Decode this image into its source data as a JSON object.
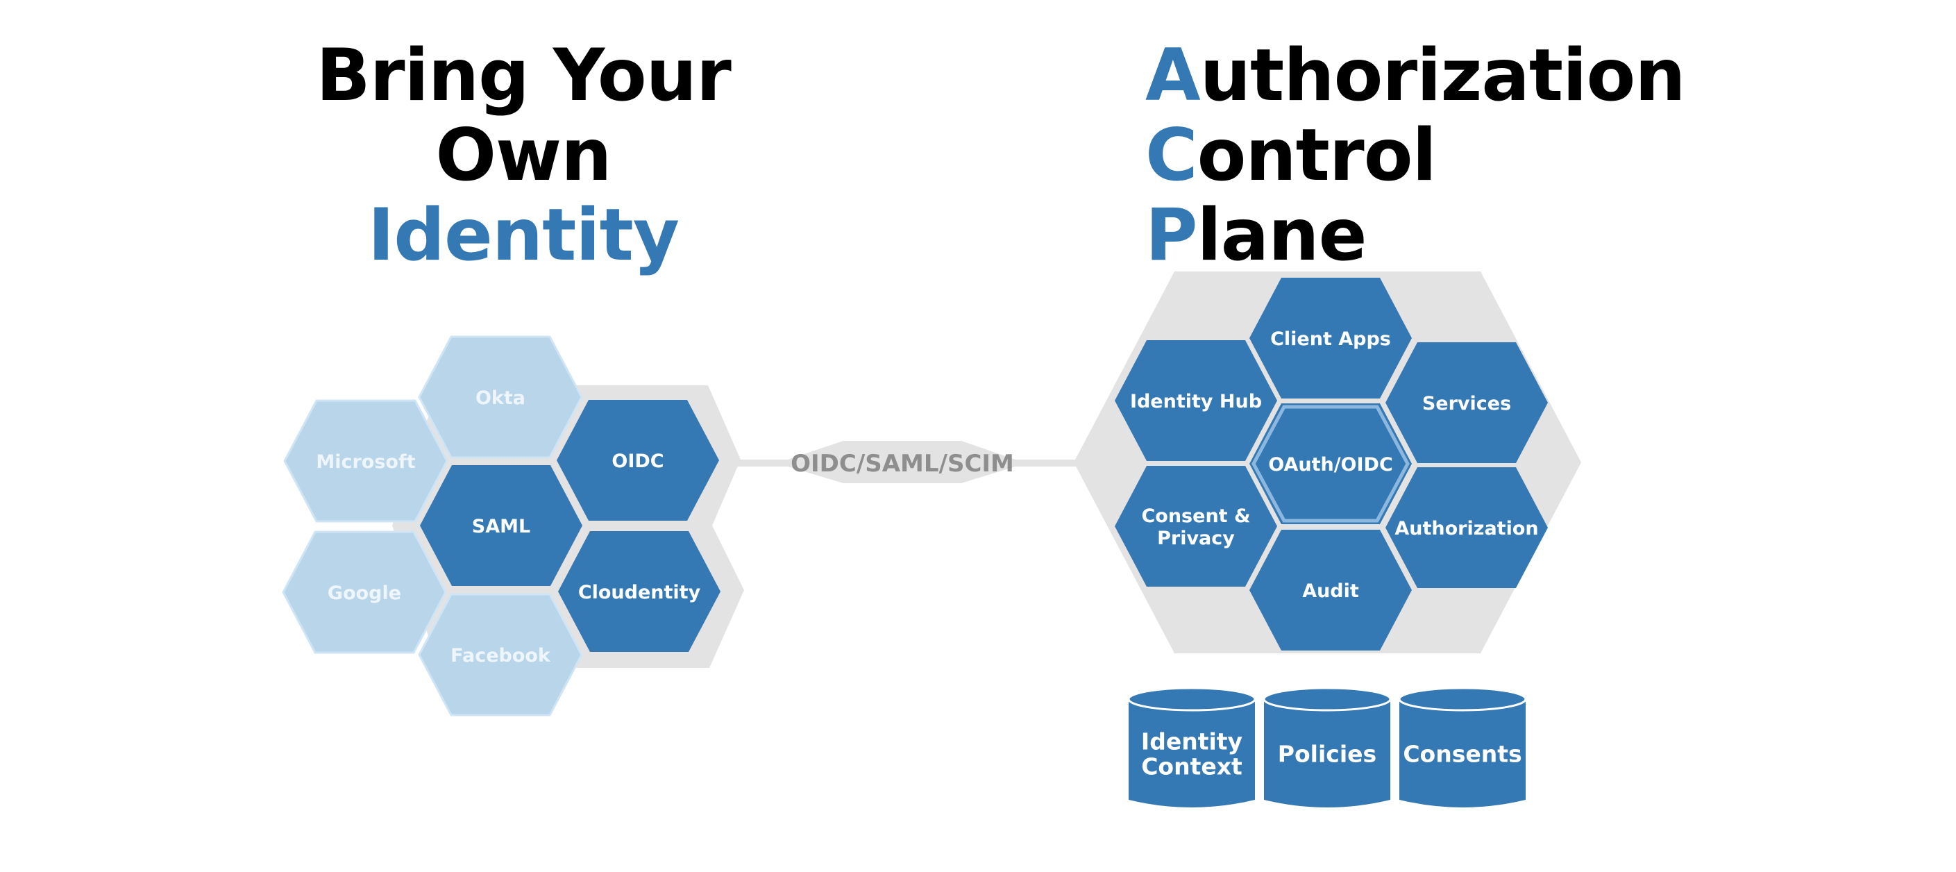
{
  "left_title": {
    "lines": [
      "Bring Your",
      "Own",
      "Identity"
    ],
    "accent_line_index": 2
  },
  "right_title": {
    "lines": [
      {
        "initial": "A",
        "rest": "uthorization"
      },
      {
        "initial": "C",
        "rest": "ontrol"
      },
      {
        "initial": "P",
        "rest": "lane"
      }
    ]
  },
  "colors": {
    "dark_blue": "#3579b4",
    "light_blue": "#b9d5ea",
    "light_blue_border": "#cfe5f6",
    "gray": "#e3e3e3",
    "connector_text": "#8e8e8e",
    "highlight_ring": "#8cb8e0"
  },
  "identity_providers": [
    {
      "label": "Okta",
      "style": "light"
    },
    {
      "label": "Microsoft",
      "style": "light"
    },
    {
      "label": "Google",
      "style": "light"
    },
    {
      "label": "Facebook",
      "style": "light"
    }
  ],
  "protocols": [
    {
      "label": "SAML",
      "style": "dark"
    },
    {
      "label": "OIDC",
      "style": "dark"
    },
    {
      "label": "Cloudentity",
      "style": "dark"
    }
  ],
  "connector": {
    "label": "OIDC/SAML/SCIM"
  },
  "acp_modules": [
    {
      "label": "Client Apps"
    },
    {
      "label": "Identity Hub"
    },
    {
      "label": "Services"
    },
    {
      "label": "OAuth/OIDC",
      "highlighted": true
    },
    {
      "label": "Consent &",
      "label2": "Privacy"
    },
    {
      "label": "Authorization"
    },
    {
      "label": "Audit"
    }
  ],
  "data_stores": [
    {
      "label": "Identity",
      "label2": "Context"
    },
    {
      "label": "Policies"
    },
    {
      "label": "Consents"
    }
  ]
}
